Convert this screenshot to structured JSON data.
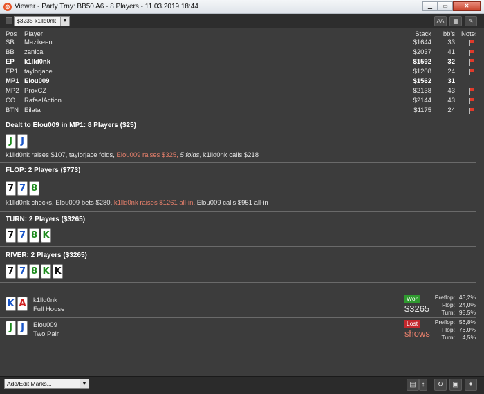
{
  "window": {
    "title": "Viewer - Party Trny: BB50 A6 - 8 Players - 11.03.2019 18:44"
  },
  "toolbar": {
    "hand_selector": "$3235 k1lld0nk"
  },
  "players_header": {
    "pos": "Pos",
    "player": "Player",
    "stack": "Stack",
    "bbs": "bb's",
    "notes": "Notes"
  },
  "players": [
    {
      "pos": "SB",
      "name": "Mazikeen",
      "stack": "$1644",
      "bbs": "33"
    },
    {
      "pos": "BB",
      "name": "zanica",
      "stack": "$2037",
      "bbs": "41"
    },
    {
      "pos": "EP",
      "name": "k1lld0nk",
      "stack": "$1592",
      "bbs": "32"
    },
    {
      "pos": "EP1",
      "name": "taylorjace",
      "stack": "$1208",
      "bbs": "24"
    },
    {
      "pos": "MP1",
      "name": "Elou009",
      "stack": "$1562",
      "bbs": "31"
    },
    {
      "pos": "MP2",
      "name": "ProxCZ",
      "stack": "$2138",
      "bbs": "43"
    },
    {
      "pos": "CO",
      "name": "RafaelAction",
      "stack": "$2144",
      "bbs": "43"
    },
    {
      "pos": "BTN",
      "name": "Eilata",
      "stack": "$1175",
      "bbs": "24"
    }
  ],
  "preflop": {
    "title": "Dealt to Elou009 in MP1: 8 Players ($25)",
    "cards": [
      {
        "rank": "J",
        "suit": "c"
      },
      {
        "rank": "J",
        "suit": "d"
      }
    ],
    "a1": "k1lld0nk raises $107, taylorjace folds, ",
    "a2": "Elou009 raises $325, ",
    "a3": "5 folds",
    "a4": ", k1lld0nk calls $218"
  },
  "flop": {
    "title": "FLOP: 2 Players ($773)",
    "cards": [
      {
        "rank": "7",
        "suit": "s"
      },
      {
        "rank": "7",
        "suit": "d"
      },
      {
        "rank": "8",
        "suit": "c"
      }
    ],
    "a1": "k1lld0nk checks, Elou009 bets $280, ",
    "a2": "k1lld0nk raises $1261 all-in,",
    "a3": " Elou009 calls $951 all-in"
  },
  "turn": {
    "title": "TURN: 2 Players ($3265)",
    "cards": [
      {
        "rank": "7",
        "suit": "s"
      },
      {
        "rank": "7",
        "suit": "d"
      },
      {
        "rank": "8",
        "suit": "c"
      },
      {
        "rank": "K",
        "suit": "c"
      }
    ]
  },
  "river": {
    "title": "RIVER: 2 Players ($3265)",
    "cards": [
      {
        "rank": "7",
        "suit": "s"
      },
      {
        "rank": "7",
        "suit": "d"
      },
      {
        "rank": "8",
        "suit": "c"
      },
      {
        "rank": "K",
        "suit": "c"
      },
      {
        "rank": "K",
        "suit": "s"
      }
    ]
  },
  "showdown": [
    {
      "name": "k1lld0nk",
      "hand": "Full House",
      "cards": [
        {
          "rank": "K",
          "suit": "d"
        },
        {
          "rank": "A",
          "suit": "h"
        }
      ],
      "result": "Won",
      "amount": "$3265",
      "stats": [
        {
          "label": "Preflop:",
          "value": "43,2%"
        },
        {
          "label": "Flop:",
          "value": "24,0%"
        },
        {
          "label": "Turn:",
          "value": "95,5%"
        }
      ]
    },
    {
      "name": "Elou009",
      "hand": "Two Pair",
      "cards": [
        {
          "rank": "J",
          "suit": "c"
        },
        {
          "rank": "J",
          "suit": "d"
        }
      ],
      "result": "Lost",
      "amount": "shows",
      "stats": [
        {
          "label": "Preflop:",
          "value": "56,8%"
        },
        {
          "label": "Flop:",
          "value": "76,0%"
        },
        {
          "label": "Turn:",
          "value": "4,5%"
        }
      ]
    }
  ],
  "footer": {
    "marks_placeholder": "Add/Edit Marks..."
  },
  "colors": {
    "won": "#2f9a2f",
    "lost": "#c4282d",
    "highlight": "#e8806c",
    "club": "#1b8a1b",
    "diamond": "#1a56c8",
    "heart": "#d01e1e",
    "spade": "#111111"
  },
  "icons": [
    "app-icon",
    "minimize-icon",
    "maximize-icon",
    "close-icon",
    "font-size-icon",
    "grid-icon",
    "pencil-icon",
    "note-flag-icon",
    "clipboard-icon",
    "sort-icon",
    "replay-icon",
    "save-icon",
    "twitter-icon"
  ]
}
